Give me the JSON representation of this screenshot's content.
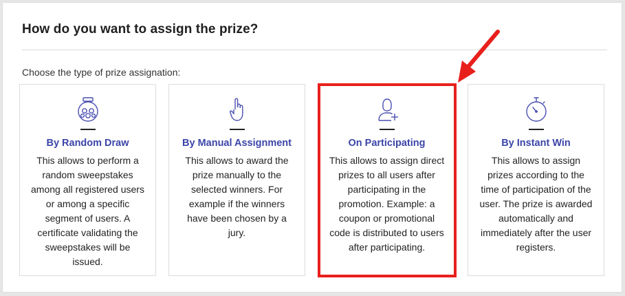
{
  "header": {
    "title": "How do you want to assign the prize?",
    "subtitle": "Choose the type of prize assignation:"
  },
  "options": [
    {
      "title": "By Random Draw",
      "description": "This allows to perform a random sweepstakes among all registered users or among a specific segment of users. A certificate validating the sweepstakes will be issued.",
      "icon": "lottery-drum-icon"
    },
    {
      "title": "By Manual Assignment",
      "description": "This allows to award the prize manually to the selected winners. For example if the winners have been chosen by a jury.",
      "icon": "hand-pointing-icon"
    },
    {
      "title": "On Participating",
      "description": "This allows to assign direct prizes to all users after participating in the promotion. Example: a coupon or promotional code is distributed to users after participating.",
      "icon": "user-add-icon"
    },
    {
      "title": "By Instant Win",
      "description": "This allows to assign prizes according to the time of participation of the user. The prize is awarded automatically and immediately after the user registers.",
      "icon": "stopwatch-icon"
    }
  ],
  "colors": {
    "accent": "#3b45a8",
    "icon": "#4a4fb0",
    "highlight": "#e8201c"
  }
}
